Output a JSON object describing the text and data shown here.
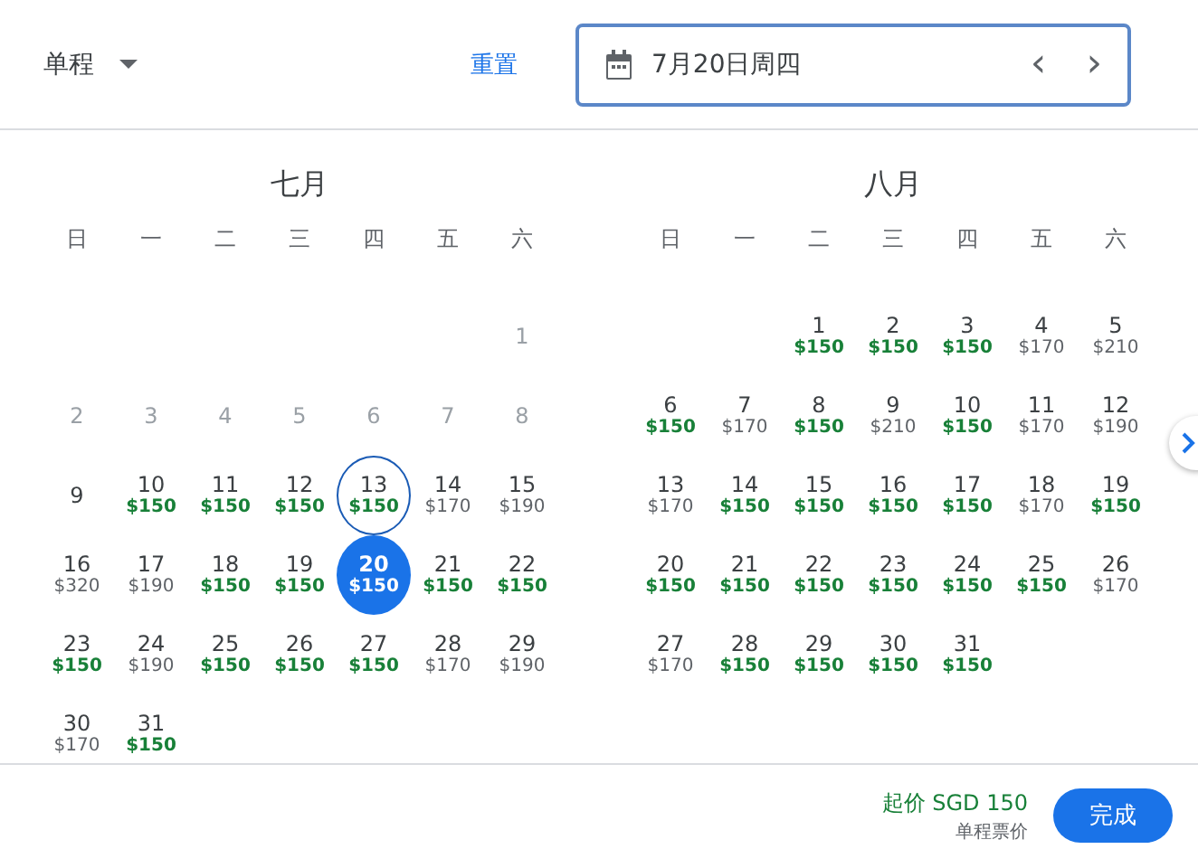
{
  "header": {
    "trip_type": "单程",
    "reset": "重置",
    "date_field": {
      "value": "7月20日周四",
      "prev": "‹",
      "next": "›"
    }
  },
  "months": [
    {
      "title": "七月",
      "weekdays": [
        "日",
        "一",
        "二",
        "三",
        "四",
        "五",
        "六"
      ],
      "weeks": [
        {
          "kind": "leading",
          "days": [
            {
              "day": "1",
              "kind": "past",
              "selected": false
            }
          ]
        },
        {
          "kind": "full",
          "days": [
            {
              "day": "2",
              "kind": "past",
              "selected": false
            },
            {
              "day": "3",
              "kind": "past",
              "selected": false
            },
            {
              "day": "4",
              "kind": "past",
              "selected": false
            },
            {
              "day": "5",
              "kind": "past",
              "selected": false
            },
            {
              "day": "6",
              "kind": "past",
              "selected": false
            },
            {
              "day": "7",
              "kind": "past",
              "selected": false
            },
            {
              "day": "8",
              "kind": "past",
              "selected": false
            }
          ]
        },
        {
          "kind": "full",
          "days": [
            {
              "day": "9",
              "kind": "open",
              "selected": false
            },
            {
              "day": "10",
              "price": "$150",
              "cheap": true,
              "kind": "open",
              "selected": false
            },
            {
              "day": "11",
              "price": "$150",
              "cheap": true,
              "kind": "open",
              "selected": false
            },
            {
              "day": "12",
              "price": "$150",
              "cheap": true,
              "kind": "open",
              "selected": false
            },
            {
              "day": "13",
              "price": "$150",
              "cheap": true,
              "kind": "focused",
              "selected": false
            },
            {
              "day": "14",
              "price": "$170",
              "cheap": false,
              "kind": "open",
              "selected": false
            },
            {
              "day": "15",
              "price": "$190",
              "cheap": false,
              "kind": "open",
              "selected": false
            }
          ]
        },
        {
          "kind": "full",
          "days": [
            {
              "day": "16",
              "price": "$320",
              "cheap": false,
              "kind": "open",
              "selected": false
            },
            {
              "day": "17",
              "price": "$190",
              "cheap": false,
              "kind": "open",
              "selected": false
            },
            {
              "day": "18",
              "price": "$150",
              "cheap": true,
              "kind": "open",
              "selected": false
            },
            {
              "day": "19",
              "price": "$150",
              "cheap": true,
              "kind": "open",
              "selected": false
            },
            {
              "day": "20",
              "price": "$150",
              "cheap": true,
              "kind": "open",
              "selected": true
            },
            {
              "day": "21",
              "price": "$150",
              "cheap": true,
              "kind": "open",
              "selected": false
            },
            {
              "day": "22",
              "price": "$150",
              "cheap": true,
              "kind": "open",
              "selected": false
            }
          ]
        },
        {
          "kind": "full",
          "days": [
            {
              "day": "23",
              "price": "$150",
              "cheap": true,
              "kind": "open",
              "selected": false
            },
            {
              "day": "24",
              "price": "$190",
              "cheap": false,
              "kind": "open",
              "selected": false
            },
            {
              "day": "25",
              "price": "$150",
              "cheap": true,
              "kind": "open",
              "selected": false
            },
            {
              "day": "26",
              "price": "$150",
              "cheap": true,
              "kind": "open",
              "selected": false
            },
            {
              "day": "27",
              "price": "$150",
              "cheap": true,
              "kind": "open",
              "selected": false
            },
            {
              "day": "28",
              "price": "$170",
              "cheap": false,
              "kind": "open",
              "selected": false
            },
            {
              "day": "29",
              "price": "$190",
              "cheap": false,
              "kind": "open",
              "selected": false
            }
          ]
        },
        {
          "kind": "trailing",
          "days": [
            {
              "day": "30",
              "price": "$170",
              "cheap": false,
              "kind": "open",
              "selected": false
            },
            {
              "day": "31",
              "price": "$150",
              "cheap": true,
              "kind": "open",
              "selected": false
            }
          ]
        }
      ]
    },
    {
      "title": "八月",
      "weekdays": [
        "日",
        "一",
        "二",
        "三",
        "四",
        "五",
        "六"
      ],
      "weeks": [
        {
          "kind": "leading",
          "days": [
            {
              "day": "1",
              "price": "$150",
              "cheap": true,
              "kind": "open",
              "selected": false
            },
            {
              "day": "2",
              "price": "$150",
              "cheap": true,
              "kind": "open",
              "selected": false
            },
            {
              "day": "3",
              "price": "$150",
              "cheap": true,
              "kind": "open",
              "selected": false
            },
            {
              "day": "4",
              "price": "$170",
              "cheap": false,
              "kind": "open",
              "selected": false
            },
            {
              "day": "5",
              "price": "$210",
              "cheap": false,
              "kind": "open",
              "selected": false
            }
          ]
        },
        {
          "kind": "full",
          "days": [
            {
              "day": "6",
              "price": "$150",
              "cheap": true,
              "kind": "open",
              "selected": false
            },
            {
              "day": "7",
              "price": "$170",
              "cheap": false,
              "kind": "open",
              "selected": false
            },
            {
              "day": "8",
              "price": "$150",
              "cheap": true,
              "kind": "open",
              "selected": false
            },
            {
              "day": "9",
              "price": "$210",
              "cheap": false,
              "kind": "open",
              "selected": false
            },
            {
              "day": "10",
              "price": "$150",
              "cheap": true,
              "kind": "open",
              "selected": false
            },
            {
              "day": "11",
              "price": "$170",
              "cheap": false,
              "kind": "open",
              "selected": false
            },
            {
              "day": "12",
              "price": "$190",
              "cheap": false,
              "kind": "open",
              "selected": false
            }
          ]
        },
        {
          "kind": "full",
          "days": [
            {
              "day": "13",
              "price": "$170",
              "cheap": false,
              "kind": "open",
              "selected": false
            },
            {
              "day": "14",
              "price": "$150",
              "cheap": true,
              "kind": "open",
              "selected": false
            },
            {
              "day": "15",
              "price": "$150",
              "cheap": true,
              "kind": "open",
              "selected": false
            },
            {
              "day": "16",
              "price": "$150",
              "cheap": true,
              "kind": "open",
              "selected": false
            },
            {
              "day": "17",
              "price": "$150",
              "cheap": true,
              "kind": "open",
              "selected": false
            },
            {
              "day": "18",
              "price": "$170",
              "cheap": false,
              "kind": "open",
              "selected": false
            },
            {
              "day": "19",
              "price": "$150",
              "cheap": true,
              "kind": "open",
              "selected": false
            }
          ]
        },
        {
          "kind": "full",
          "days": [
            {
              "day": "20",
              "price": "$150",
              "cheap": true,
              "kind": "open",
              "selected": false
            },
            {
              "day": "21",
              "price": "$150",
              "cheap": true,
              "kind": "open",
              "selected": false
            },
            {
              "day": "22",
              "price": "$150",
              "cheap": true,
              "kind": "open",
              "selected": false
            },
            {
              "day": "23",
              "price": "$150",
              "cheap": true,
              "kind": "open",
              "selected": false
            },
            {
              "day": "24",
              "price": "$150",
              "cheap": true,
              "kind": "open",
              "selected": false
            },
            {
              "day": "25",
              "price": "$150",
              "cheap": true,
              "kind": "open",
              "selected": false
            },
            {
              "day": "26",
              "price": "$170",
              "cheap": false,
              "kind": "open",
              "selected": false
            }
          ]
        },
        {
          "kind": "trailing",
          "days": [
            {
              "day": "27",
              "price": "$170",
              "cheap": false,
              "kind": "open",
              "selected": false
            },
            {
              "day": "28",
              "price": "$150",
              "cheap": true,
              "kind": "open",
              "selected": false
            },
            {
              "day": "29",
              "price": "$150",
              "cheap": true,
              "kind": "open",
              "selected": false
            },
            {
              "day": "30",
              "price": "$150",
              "cheap": true,
              "kind": "open",
              "selected": false
            },
            {
              "day": "31",
              "price": "$150",
              "cheap": true,
              "kind": "open",
              "selected": false
            }
          ]
        }
      ]
    }
  ],
  "footer": {
    "price": "起价 SGD 150",
    "price_note": "单程票价",
    "done": "完成"
  }
}
